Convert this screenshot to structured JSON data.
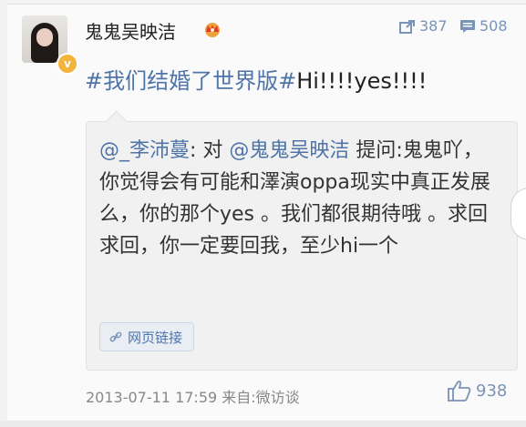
{
  "post": {
    "username": "鬼鬼吴映洁",
    "repost_count": "387",
    "comment_count": "508",
    "topic": "#我们结婚了世界版#",
    "text_after_topic": "Hi!!!!yes!!!!"
  },
  "repost": {
    "mention_author": "@_李沛蔓",
    "text_a": ": 对 ",
    "mention_target": "@鬼鬼吴映洁",
    "text_b": " 提问:鬼鬼吖，你觉得会有可能和澤演oppa现实中真正发展么，你的那个yes 。我们都很期待哦 。求回求回，你一定要回我，至少hi一个",
    "link_label": "网页链接"
  },
  "footer": {
    "timestamp": "2013-07-11 17:59",
    "source": "来自:微访谈",
    "like_count": "938"
  },
  "colors": {
    "link": "#4e74a8",
    "icon": "#7a94b8",
    "badge": "#f3b43c"
  },
  "icons": {
    "repost": "repost-icon",
    "comment": "comment-icon",
    "like": "thumbs-up-icon",
    "link": "link-icon",
    "crown": "crown-icon",
    "verified": "verified-badge-icon"
  }
}
